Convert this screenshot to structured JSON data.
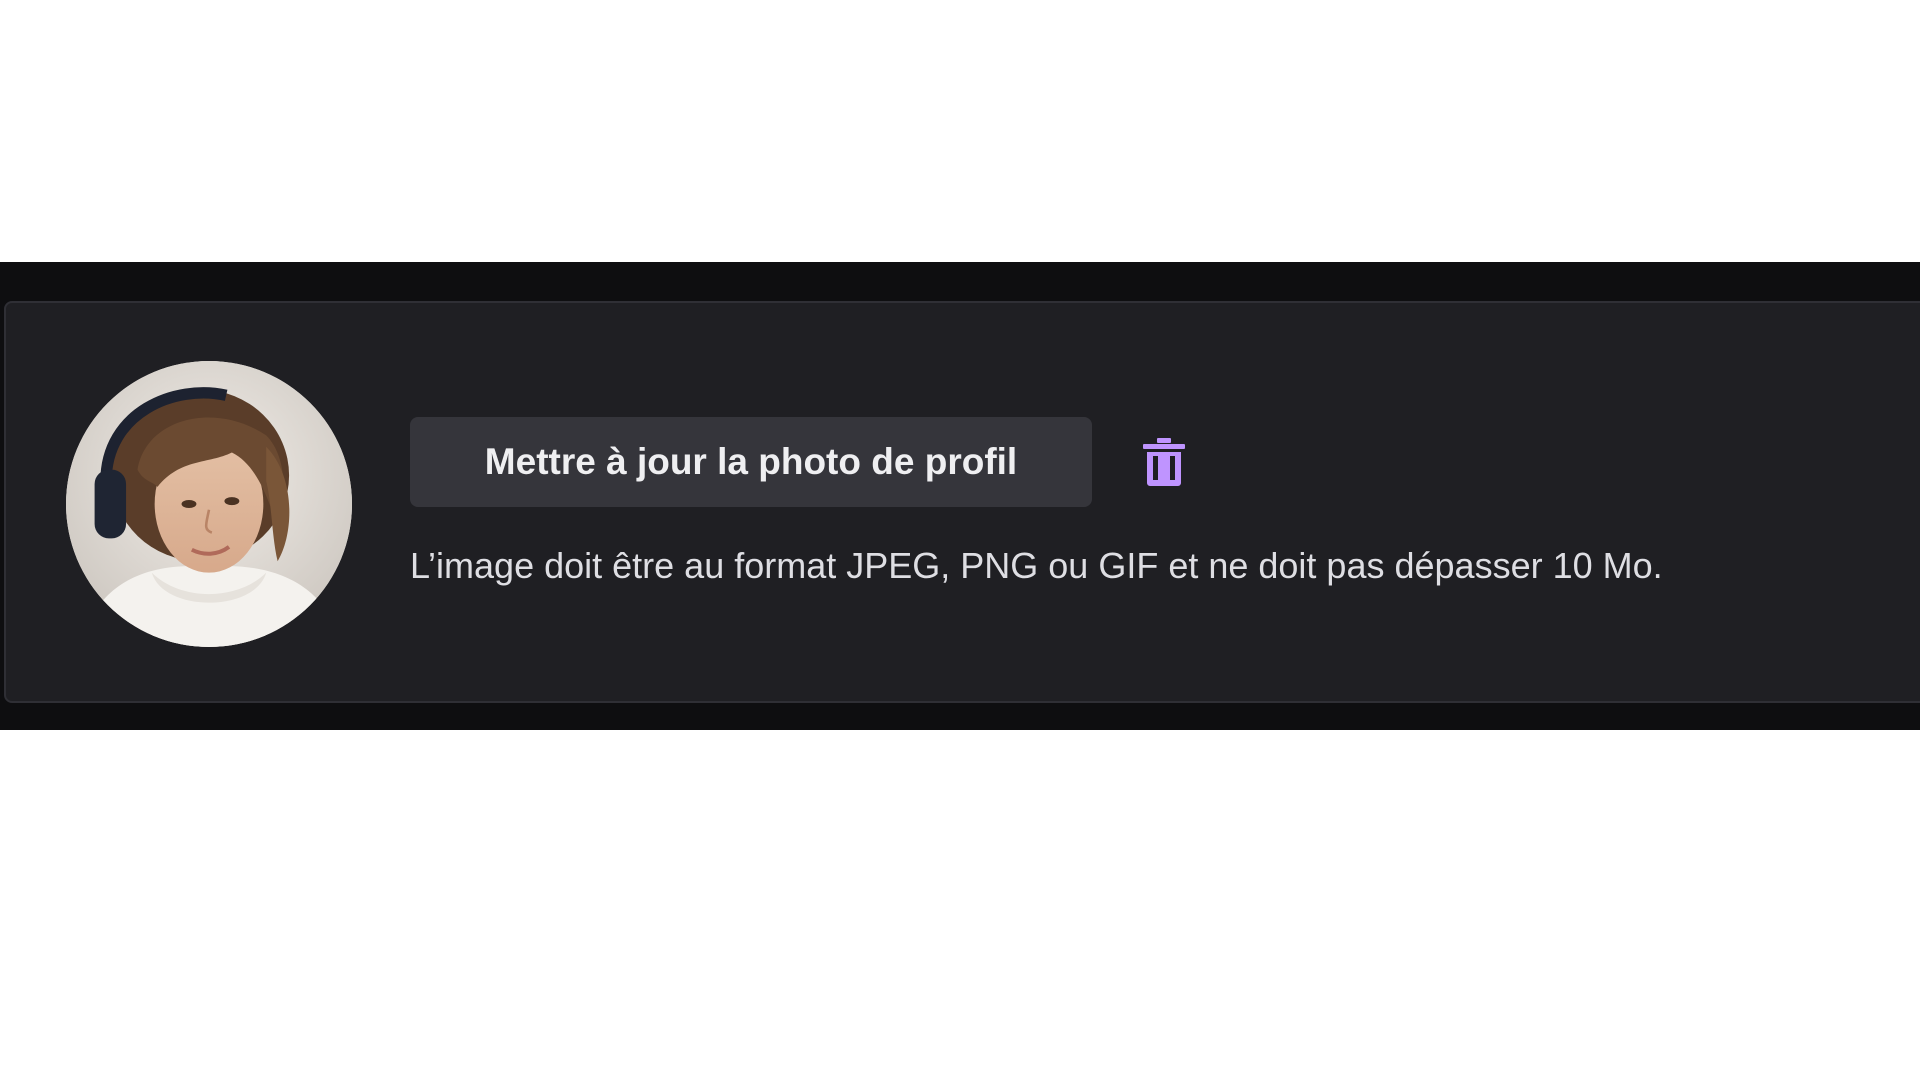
{
  "profile_photo": {
    "update_button_label": "Mettre à jour la photo de profil",
    "delete_icon": "trash-icon",
    "hint_text": "L’image doit être au format JPEG, PNG ou GIF et ne doit pas dépasser 10 Mo."
  },
  "colors": {
    "page_background": "#0e0e10",
    "card_background": "#1f1f23",
    "button_background": "#35353b",
    "accent": "#bf94ff",
    "text": "#efeff1"
  }
}
